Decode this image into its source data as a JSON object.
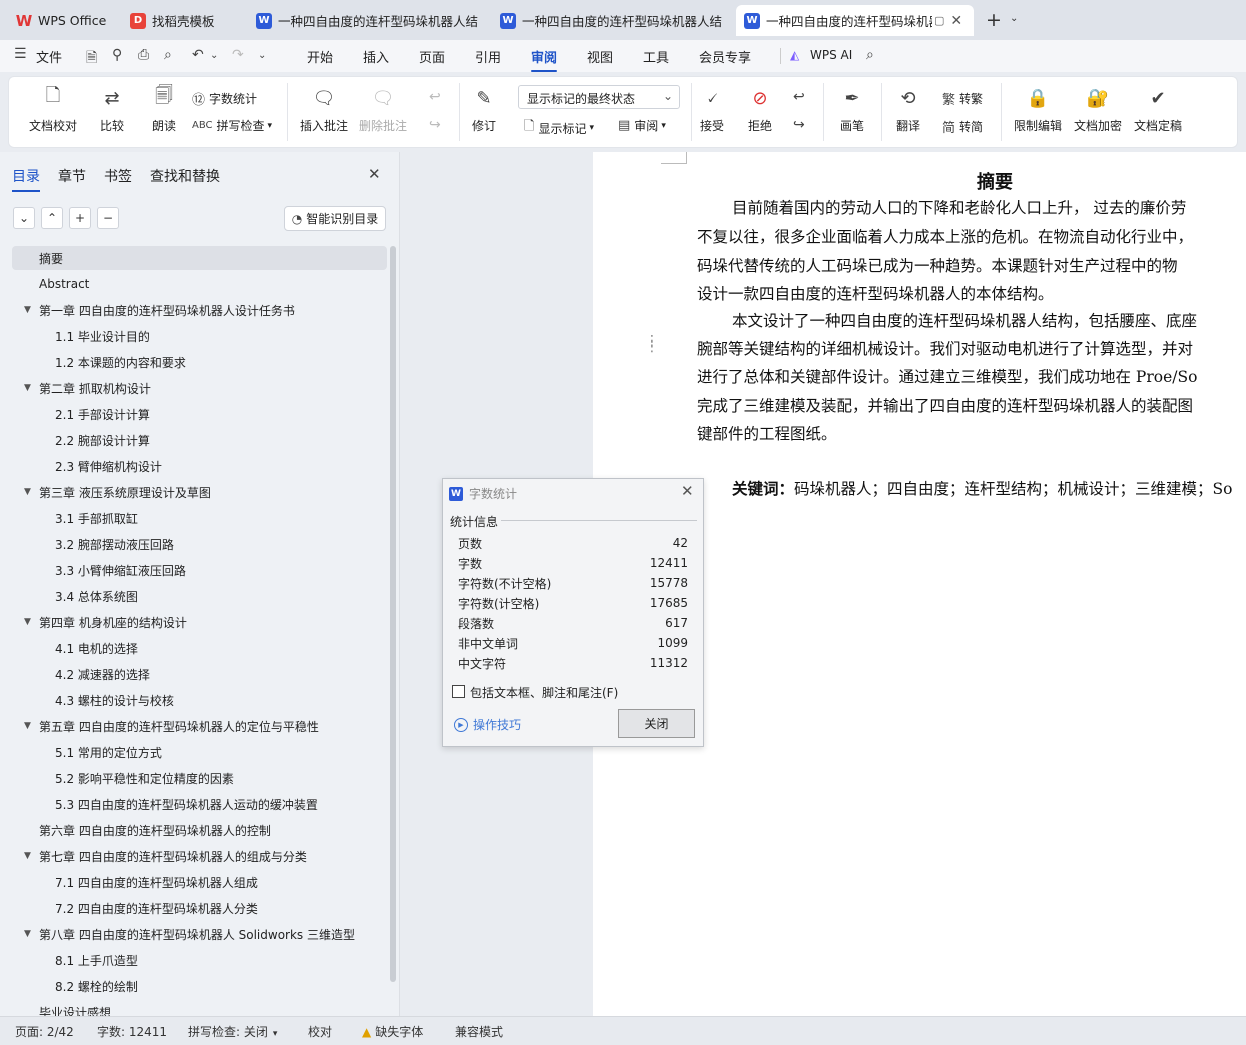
{
  "tabs": [
    {
      "label": "WPS Office",
      "icon": "wps-logo-icon"
    },
    {
      "label": "找稻壳模板",
      "icon": "docer-icon"
    },
    {
      "label": "一种四自由度的连杆型码垛机器人结构",
      "icon": "word-doc-icon"
    },
    {
      "label": "一种四自由度的连杆型码垛机器人结构",
      "icon": "word-doc-icon"
    },
    {
      "label": "一种四自由度的连杆型码垛机器人",
      "icon": "word-doc-icon"
    }
  ],
  "menu": {
    "file": "文件",
    "items": [
      "开始",
      "插入",
      "页面",
      "引用",
      "审阅",
      "视图",
      "工具",
      "会员专享"
    ],
    "active": "审阅",
    "ai": "WPS AI"
  },
  "ribbon": {
    "doc_proof": "文档校对",
    "compare": "比较",
    "read_aloud": "朗读",
    "word_count": "字数统计",
    "spell_check": "拼写检查",
    "insert_comment": "插入批注",
    "delete_comment": "删除批注",
    "revise": "修订",
    "markup_state": "显示标记的最终状态",
    "show_markup": "显示标记",
    "review": "审阅",
    "accept": "接受",
    "reject": "拒绝",
    "pen": "画笔",
    "translate": "翻译",
    "to_traditional": "转繁",
    "to_simplified": "转简",
    "restrict_edit": "限制编辑",
    "encrypt": "文档加密",
    "finalize": "文档定稿"
  },
  "panel": {
    "tabs": [
      "目录",
      "章节",
      "书签",
      "查找和替换"
    ],
    "smart_toc": "智能识别目录",
    "toc": [
      {
        "t": "摘要",
        "lv": 0,
        "sel": true
      },
      {
        "t": "Abstract",
        "lv": 0
      },
      {
        "t": "第一章  四自由度的连杆型码垛机器人设计任务书",
        "lv": 0,
        "exp": true
      },
      {
        "t": "1.1 毕业设计目的",
        "lv": 1
      },
      {
        "t": "1.2 本课题的内容和要求",
        "lv": 1
      },
      {
        "t": "第二章  抓取机构设计",
        "lv": 0,
        "exp": true
      },
      {
        "t": "2.1 手部设计计算",
        "lv": 1
      },
      {
        "t": "2.2 腕部设计计算",
        "lv": 1
      },
      {
        "t": "2.3 臂伸缩机构设计",
        "lv": 1
      },
      {
        "t": "第三章  液压系统原理设计及草图",
        "lv": 0,
        "exp": true
      },
      {
        "t": "3.1 手部抓取缸",
        "lv": 1
      },
      {
        "t": "3.2 腕部摆动液压回路",
        "lv": 1
      },
      {
        "t": "3.3 小臂伸缩缸液压回路",
        "lv": 1
      },
      {
        "t": "3.4 总体系统图",
        "lv": 1
      },
      {
        "t": "第四章  机身机座的结构设计",
        "lv": 0,
        "exp": true
      },
      {
        "t": "4.1 电机的选择",
        "lv": 1
      },
      {
        "t": "4.2 减速器的选择",
        "lv": 1
      },
      {
        "t": "4.3 螺柱的设计与校核",
        "lv": 1
      },
      {
        "t": "第五章  四自由度的连杆型码垛机器人的定位与平稳性",
        "lv": 0,
        "exp": true
      },
      {
        "t": "5.1 常用的定位方式",
        "lv": 1
      },
      {
        "t": "5.2 影响平稳性和定位精度的因素",
        "lv": 1
      },
      {
        "t": "5.3 四自由度的连杆型码垛机器人运动的缓冲装置",
        "lv": 1
      },
      {
        "t": "第六章  四自由度的连杆型码垛机器人的控制",
        "lv": 0
      },
      {
        "t": "第七章  四自由度的连杆型码垛机器人的组成与分类",
        "lv": 0,
        "exp": true
      },
      {
        "t": "7.1 四自由度的连杆型码垛机器人组成",
        "lv": 1
      },
      {
        "t": "7.2 四自由度的连杆型码垛机器人分类",
        "lv": 1
      },
      {
        "t": "第八章  四自由度的连杆型码垛机器人 Solidworks 三维造型",
        "lv": 0,
        "exp": true
      },
      {
        "t": "8.1 上手爪造型",
        "lv": 1
      },
      {
        "t": "8.2 螺栓的绘制",
        "lv": 1
      },
      {
        "t": "毕业设计感想",
        "lv": 0
      }
    ]
  },
  "doc": {
    "heading": "摘要",
    "lines": [
      "目前随着国内的劳动人口的下降和老龄化人口上升，  过去的廉价劳",
      "不复以往，很多企业面临着人力成本上涨的危机。在物流自动化行业中，",
      "码垛代替传统的人工码垛已成为一种趋势。本课题针对生产过程中的物",
      "设计一款四自由度的连杆型码垛机器人的本体结构。",
      "本文设计了一种四自由度的连杆型码垛机器人结构，包括腰座、底座",
      "腕部等关键结构的详细机械设计。我们对驱动电机进行了计算选型，并对",
      "进行了总体和关键部件设计。通过建立三维模型，我们成功地在 Proe/So",
      "完成了三维建模及装配，并输出了四自由度的连杆型码垛机器人的装配图",
      "键部件的工程图纸。"
    ],
    "keywords_label": "关键词：",
    "keywords": "码垛机器人；四自由度；连杆型结构；机械设计；三维建模；So"
  },
  "dialog": {
    "title": "字数统计",
    "section": "统计信息",
    "stats": [
      {
        "k": "页数",
        "v": "42"
      },
      {
        "k": "字数",
        "v": "12411"
      },
      {
        "k": "字符数(不计空格)",
        "v": "15778"
      },
      {
        "k": "字符数(计空格)",
        "v": "17685"
      },
      {
        "k": "段落数",
        "v": "617"
      },
      {
        "k": "非中文单词",
        "v": "1099"
      },
      {
        "k": "中文字符",
        "v": "11312"
      }
    ],
    "include_label": "包括文本框、脚注和尾注(F)",
    "tips": "操作技巧",
    "close": "关闭"
  },
  "status": {
    "page": "页面: 2/42",
    "words": "字数: 12411",
    "spell": "拼写检查: 关闭",
    "proof": "校对",
    "missing_font": "缺失字体",
    "compat": "兼容模式"
  }
}
